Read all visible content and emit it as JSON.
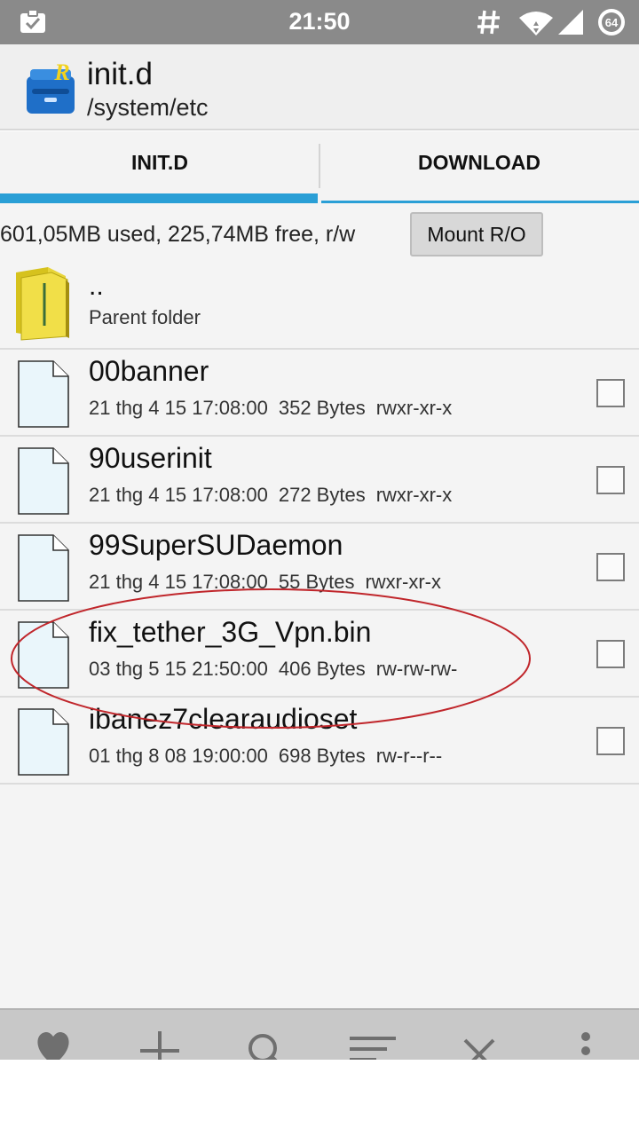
{
  "status_bar": {
    "time": "21:50",
    "icons": [
      "clipboard-check-icon",
      "hash-icon",
      "wifi-icon",
      "signal-icon",
      "badge-icon"
    ],
    "badge_text": "64"
  },
  "action_bar": {
    "title": "init.d",
    "subtitle": "/system/etc",
    "logo_icon": "root-explorer-logo-icon"
  },
  "tabs": [
    {
      "label": "INIT.D",
      "selected": true
    },
    {
      "label": "DOWNLOAD",
      "selected": false
    }
  ],
  "storage": {
    "info": "601,05MB used, 225,74MB free, r/w",
    "mount_button": "Mount R/O"
  },
  "parent": {
    "name": "..",
    "label": "Parent folder",
    "icon": "folder-icon"
  },
  "files": [
    {
      "name": "00banner",
      "date": "21 thg 4 15 17:08:00",
      "size": "352 Bytes",
      "perms": "rwxr-xr-x"
    },
    {
      "name": "90userinit",
      "date": "21 thg 4 15 17:08:00",
      "size": "272 Bytes",
      "perms": "rwxr-xr-x"
    },
    {
      "name": "99SuperSUDaemon",
      "date": "21 thg 4 15 17:08:00",
      "size": "55 Bytes",
      "perms": "rwxr-xr-x"
    },
    {
      "name": "fix_tether_3G_Vpn.bin",
      "date": "03 thg 5 15 21:50:00",
      "size": "406 Bytes",
      "perms": "rw-rw-rw-"
    },
    {
      "name": "ibanez7clearaudioset",
      "date": "01 thg 8 08 19:00:00",
      "size": "698 Bytes",
      "perms": "rw-r--r--"
    }
  ],
  "bottom_bar": [
    "favorite-heart-icon",
    "add-icon",
    "search-icon",
    "sort-icon",
    "close-icon",
    "overflow-menu-icon"
  ],
  "colors": {
    "accent": "#2a9fd6",
    "status_bar": "#8a8a8a",
    "highlight_oval": "#c0262b"
  }
}
